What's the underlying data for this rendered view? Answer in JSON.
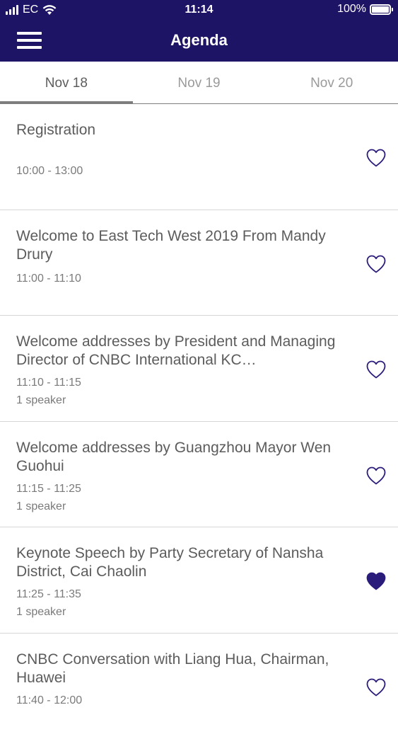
{
  "status": {
    "carrier": "EC",
    "time": "11:14",
    "battery": "100%"
  },
  "nav": {
    "title": "Agenda"
  },
  "tabs": [
    {
      "label": "Nov 18",
      "active": true
    },
    {
      "label": "Nov 19",
      "active": false
    },
    {
      "label": "Nov 20",
      "active": false
    }
  ],
  "items": [
    {
      "title": "Registration",
      "time": "10:00 - 13:00",
      "speaker": "",
      "favorited": false
    },
    {
      "title": "Welcome to East Tech West 2019 From Mandy Drury",
      "time": "11:00 - 11:10",
      "speaker": "",
      "favorited": false
    },
    {
      "title": "Welcome addresses by President and Managing Director of CNBC International KC…",
      "time": "11:10 - 11:15",
      "speaker": "1 speaker",
      "favorited": false
    },
    {
      "title": "Welcome addresses by Guangzhou Mayor Wen Guohui",
      "time": "11:15 - 11:25",
      "speaker": "1 speaker",
      "favorited": false
    },
    {
      "title": "Keynote Speech by Party Secretary of Nansha District, Cai Chaolin",
      "time": "11:25 - 11:35",
      "speaker": "1 speaker",
      "favorited": true
    },
    {
      "title": "CNBC Conversation with Liang Hua, Chairman, Huawei",
      "time": "11:40 - 12:00",
      "speaker": "",
      "favorited": false
    }
  ],
  "colors": {
    "brand": "#1e1466",
    "text_primary": "#5c5c5c",
    "text_secondary": "#7a7a7a",
    "heart": "#2a1c7a"
  }
}
